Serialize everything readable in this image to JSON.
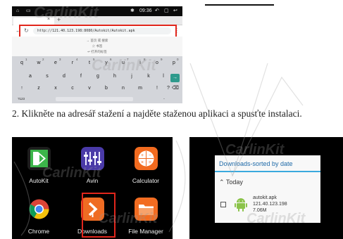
{
  "browser": {
    "status_time": "09:36",
    "url": "http://121.40.123.198:8080/Autokit/Autokit.apk",
    "suggestions": [
      "→ 首页 或 搜索",
      "☆ 书签",
      "↩ 打开的标签"
    ],
    "keyboard": {
      "row1_nums": [
        "1",
        "2",
        "3",
        "4",
        "5",
        "6",
        "7",
        "8",
        "9",
        "0"
      ],
      "row1": [
        "q",
        "w",
        "e",
        "r",
        "t",
        "y",
        "u",
        "i",
        "o",
        "p"
      ],
      "row2": [
        "a",
        "s",
        "d",
        "f",
        "g",
        "h",
        "j",
        "k",
        "l"
      ],
      "row3": [
        "z",
        "x",
        "c",
        "v",
        "b",
        "n",
        "m",
        "!",
        "?"
      ],
      "shift": "↑",
      "enter": "→",
      "backspace": "⌫",
      "bottom_left": "?123",
      "dot": "."
    }
  },
  "instruction_text": "2. Klikněte na adresář stažení a najděte staženou aplikaci a spusťte instalaci.",
  "launcher": {
    "apps": [
      {
        "label": "AutoKit",
        "icon": "autokit-icon",
        "color": "#1b1b1b"
      },
      {
        "label": "Avin",
        "icon": "equalizer-icon",
        "color": "#3e2f8f"
      },
      {
        "label": "Calculator",
        "icon": "calculator-icon",
        "color": "#f06a1e"
      },
      {
        "label": "Chrome",
        "icon": "chrome-icon",
        "color": "#111111"
      },
      {
        "label": "Downloads",
        "icon": "download-arrow-icon",
        "color": "#ef6c23"
      },
      {
        "label": "File Manager",
        "icon": "folder-icon",
        "color": "#f26c21"
      }
    ]
  },
  "downloads": {
    "title": "Downloads-sorted by date",
    "section": "Today",
    "file": {
      "name": "autokit.apk",
      "source": "121.40.123.198",
      "size": "7.06M"
    }
  },
  "watermark": "CarlinKit"
}
